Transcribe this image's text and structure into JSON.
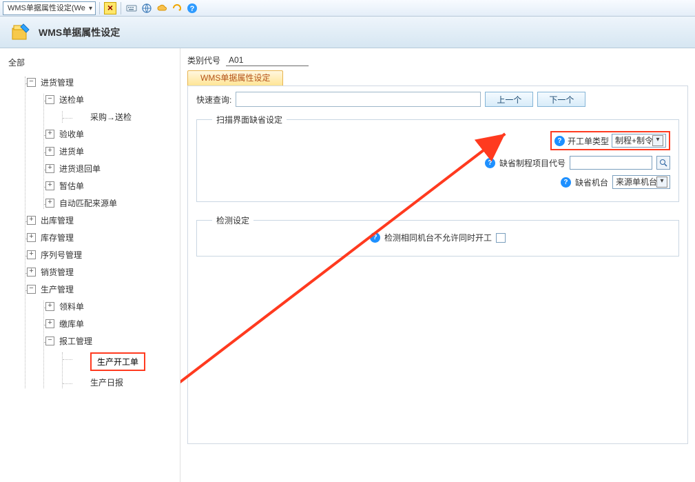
{
  "toolbar": {
    "dropdown_text": "WMS单据属性设定(We"
  },
  "header": {
    "title": "WMS单据属性设定"
  },
  "tree": {
    "root": "全部",
    "nodes": [
      {
        "label": "进货管理",
        "state": "-",
        "children": [
          {
            "label": "送检单",
            "state": "-",
            "children": [
              {
                "label": "采购→送检",
                "leaf": true
              }
            ]
          },
          {
            "label": "验收单",
            "state": "+"
          },
          {
            "label": "进货单",
            "state": "+"
          },
          {
            "label": "进货退回单",
            "state": "+"
          },
          {
            "label": "暂估单",
            "state": "+"
          },
          {
            "label": "自动匹配来源单",
            "state": "+"
          }
        ]
      },
      {
        "label": "出库管理",
        "state": "+"
      },
      {
        "label": "库存管理",
        "state": "+"
      },
      {
        "label": "序列号管理",
        "state": "+"
      },
      {
        "label": "销货管理",
        "state": "+"
      },
      {
        "label": "生产管理",
        "state": "-",
        "children": [
          {
            "label": "领料单",
            "state": "+"
          },
          {
            "label": "缴库单",
            "state": "+"
          },
          {
            "label": "报工管理",
            "state": "-",
            "children": [
              {
                "label": "生产开工单",
                "leaf": true,
                "hot": true
              },
              {
                "label": "生产日报",
                "leaf": true
              }
            ]
          }
        ]
      }
    ]
  },
  "main": {
    "cat_label": "类别代号",
    "cat_value": "A01",
    "tab": "WMS单据属性设定",
    "quick_query_label": "快速查询:",
    "prev_btn": "上一个",
    "next_btn": "下一个",
    "fs1": {
      "legend": "扫描界面缺省设定",
      "type_label": "开工单类型",
      "type_value": "制程+制令",
      "proj_label": "缺省制程项目代号",
      "machine_label": "缺省机台",
      "machine_value": "来源单机台"
    },
    "fs2": {
      "legend": "检测设定",
      "check_label": "检测相同机台不允许同时开工"
    }
  }
}
